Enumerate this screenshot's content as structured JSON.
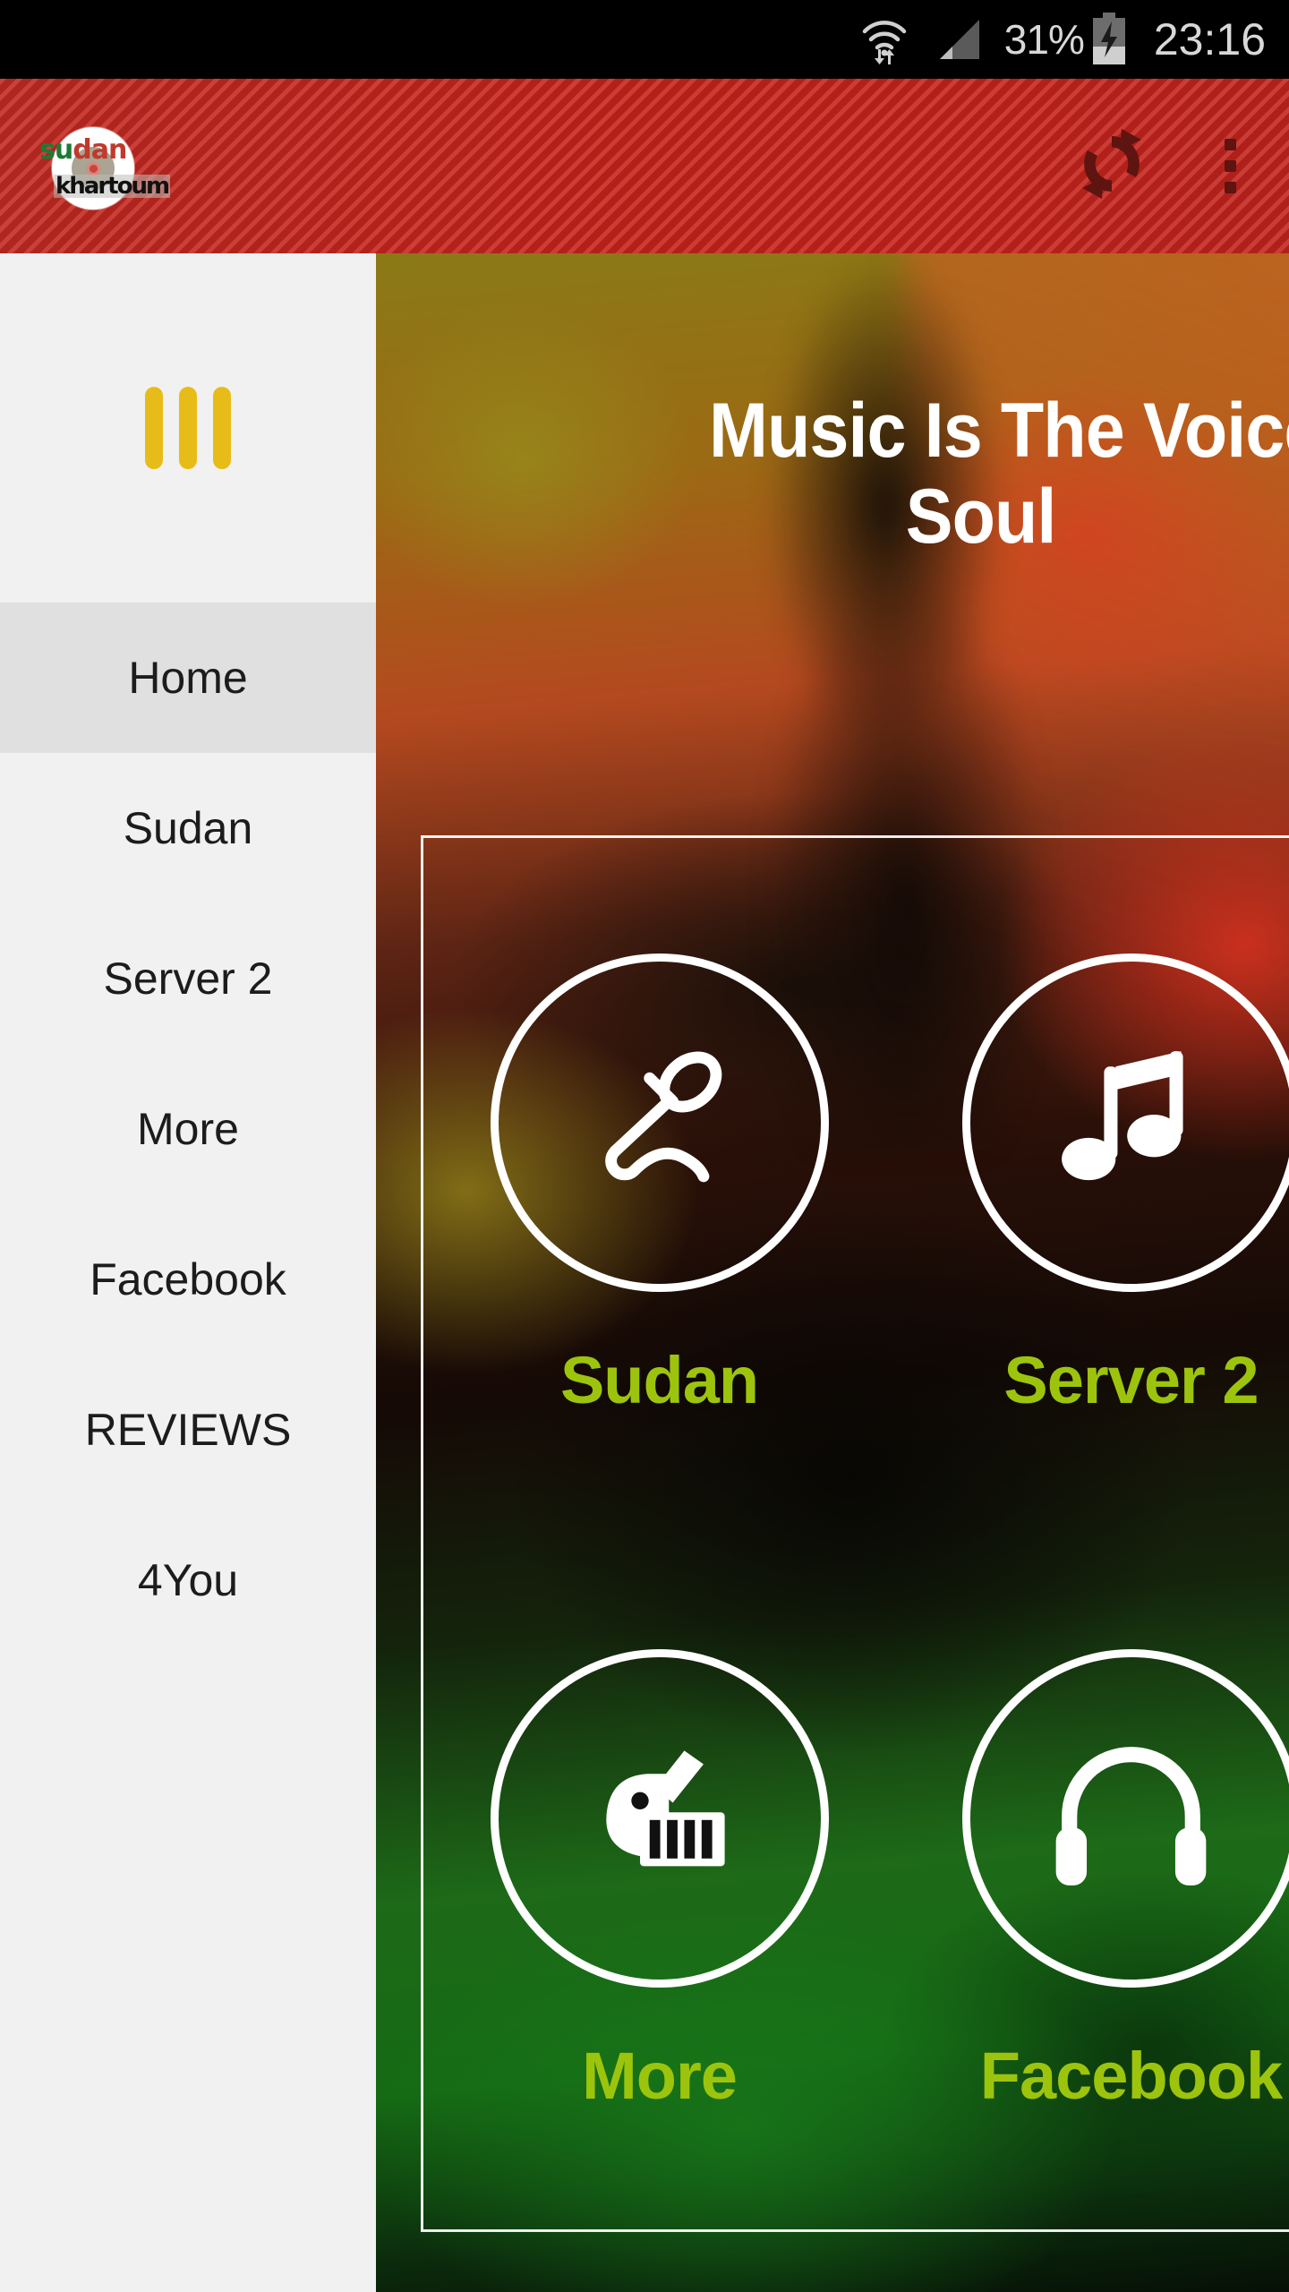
{
  "status_bar": {
    "wifi_icon": "wifi-with-data-arrows-icon",
    "signal_icon": "cellular-signal-icon",
    "battery_percent": "31%",
    "battery_icon": "battery-charging-icon",
    "clock": "23:16"
  },
  "app_bar": {
    "logo": {
      "word_top_green": "su",
      "word_top_red": "dan",
      "word_bottom": "khartoum",
      "name": "sudan-khartoum-logo"
    },
    "actions": [
      {
        "name": "refresh-button",
        "icon": "refresh-icon"
      },
      {
        "name": "overflow-menu-button",
        "icon": "three-dot-menu-icon"
      }
    ],
    "accent_color": "#c8231b"
  },
  "sidebar": {
    "logo_icon": "three-bars-logo-icon",
    "logo_color": "#e8bc18",
    "background_color": "#f1f1f1",
    "active_background_color": "#e0e0e0",
    "items": [
      {
        "label": "Home",
        "name": "sidebar-item-home",
        "active": true
      },
      {
        "label": "Sudan",
        "name": "sidebar-item-sudan",
        "active": false
      },
      {
        "label": "Server 2",
        "name": "sidebar-item-server-2",
        "active": false
      },
      {
        "label": "More",
        "name": "sidebar-item-more",
        "active": false
      },
      {
        "label": "Facebook",
        "name": "sidebar-item-facebook",
        "active": false
      },
      {
        "label": "REVIEWS",
        "name": "sidebar-item-reviews",
        "active": false
      },
      {
        "label": "4You",
        "name": "sidebar-item-4you",
        "active": false
      }
    ]
  },
  "main": {
    "headline_line1": "Music Is The Voice Of The",
    "headline_line2": "Soul",
    "label_color": "#9dc40c",
    "tiles": [
      {
        "label": "Sudan",
        "icon": "microphone-icon",
        "name": "tile-sudan"
      },
      {
        "label": "Server 2",
        "icon": "music-note-icon",
        "name": "tile-server-2"
      },
      {
        "label": "More",
        "icon": "guitar-keyboard-icon",
        "name": "tile-more"
      },
      {
        "label": "Facebook",
        "icon": "headphones-icon",
        "name": "tile-facebook"
      }
    ]
  }
}
